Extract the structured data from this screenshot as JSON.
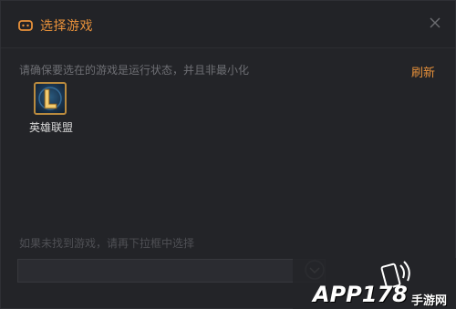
{
  "dialog": {
    "title": "选择游戏",
    "title_icon": "gamepad-icon",
    "close_icon": "close-icon",
    "hint_top": "请确保要选在的游戏是运行状态，并且非最小化",
    "refresh_label": "刷新",
    "games": [
      {
        "name": "英雄联盟",
        "icon": "league-of-legends-icon"
      }
    ],
    "hint_bottom": "如果未找到游戏，请再下拉框中选择",
    "dropdown_value": "",
    "dropdown_icon": "chevron-down-icon"
  },
  "watermark": {
    "main": "APP178",
    "sub": "手游网",
    "icon": "phone-signal-icon"
  },
  "colors": {
    "accent": "#e8913a",
    "background": "#232428",
    "muted_text": "#6e6f74"
  }
}
